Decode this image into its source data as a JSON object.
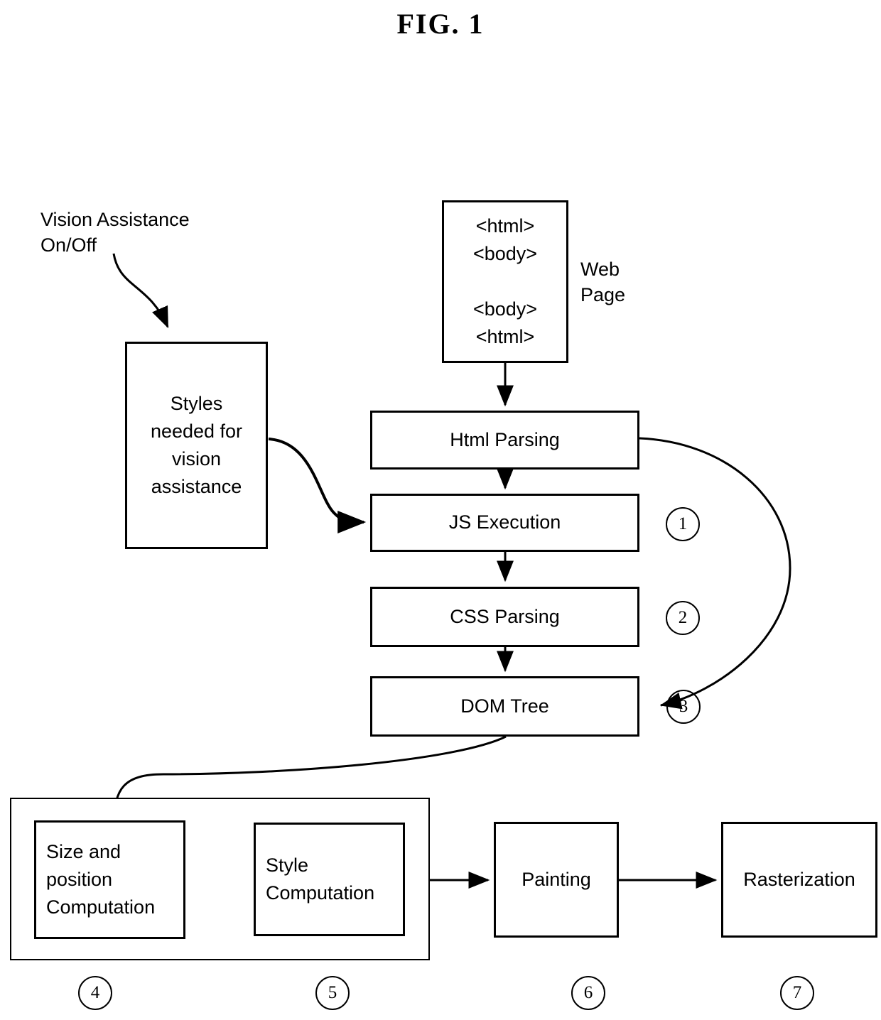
{
  "figure": {
    "title": "FIG.  1"
  },
  "labels": {
    "vision_toggle": "Vision Assistance\nOn/Off",
    "web_page": "Web\nPage"
  },
  "boxes": {
    "styles": "Styles\nneeded for\nvision\nassistance",
    "web_page_code": "<html>\n<body>\n\n<body>\n<html>",
    "html_parsing": "Html Parsing",
    "js_execution": "JS Execution",
    "css_parsing": "CSS Parsing",
    "dom_tree": "DOM Tree",
    "size_position": "Size and\nposition\nComputation",
    "style_computation": "Style\nComputation",
    "painting": "Painting",
    "rasterization": "Rasterization"
  },
  "refs": {
    "r1": "1",
    "r2": "2",
    "r3": "3",
    "r4": "4",
    "r5": "5",
    "r6": "6",
    "r7": "7"
  },
  "colors": {
    "stroke": "#000000",
    "background": "#ffffff"
  }
}
